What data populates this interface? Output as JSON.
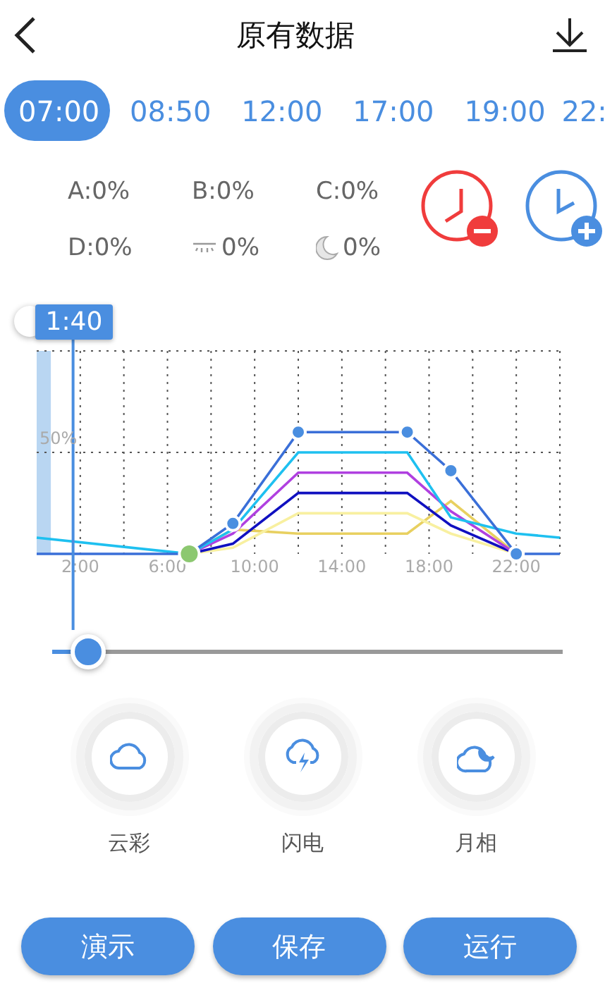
{
  "header": {
    "title": "原有数据"
  },
  "time_tabs": [
    {
      "label": "07:00",
      "selected": true
    },
    {
      "label": "08:50",
      "selected": false
    },
    {
      "label": "12:00",
      "selected": false
    },
    {
      "label": "17:00",
      "selected": false
    },
    {
      "label": "19:00",
      "selected": false
    },
    {
      "label": "22:",
      "selected": false
    }
  ],
  "channel_values": [
    [
      {
        "kind": "letter",
        "label": "A:",
        "value": "0%"
      },
      {
        "kind": "letter",
        "label": "B:",
        "value": "0%"
      },
      {
        "kind": "letter",
        "label": "C:",
        "value": "0%"
      }
    ],
    [
      {
        "kind": "letter",
        "label": "D:",
        "value": "0%"
      },
      {
        "kind": "dusk",
        "value": "0%"
      },
      {
        "kind": "moon",
        "value": "0%"
      }
    ]
  ],
  "time_point_buttons": [
    {
      "kind": "remove"
    },
    {
      "kind": "add"
    }
  ],
  "chart": {
    "cursor_label": "1:40",
    "y_label": "50%",
    "x_labels": [
      "2:00",
      "6:00",
      "10:00",
      "14:00",
      "18:00",
      "22:00"
    ]
  },
  "time_slider": {
    "level": 0.07
  },
  "effects": [
    {
      "kind": "cloud",
      "label": "云彩"
    },
    {
      "kind": "lightning",
      "label": "闪电"
    },
    {
      "kind": "moon-cloud",
      "label": "月相"
    }
  ],
  "buttons": [
    {
      "label": "演示"
    },
    {
      "label": "保存"
    },
    {
      "label": "运行"
    }
  ]
}
